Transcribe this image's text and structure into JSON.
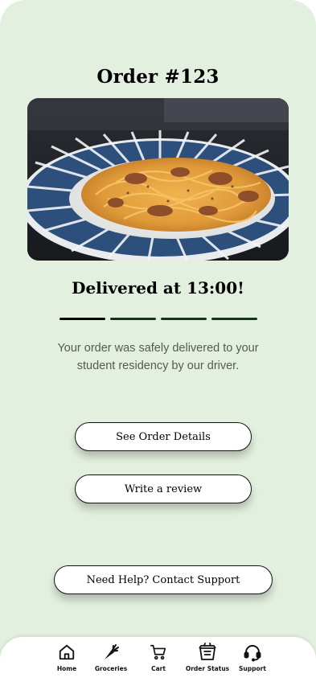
{
  "order": {
    "title": "Order #123"
  },
  "hero": {
    "alt": "spaghetti-carbonara-photo"
  },
  "status": {
    "heading": "Delivered at 13:00!",
    "progress_steps": 4,
    "progress_completed": 4,
    "colors": {
      "step1": "#000000",
      "steps_other": "#0d3a12"
    }
  },
  "description": "Your order was safely delivered to your student residency by our driver.",
  "buttons": {
    "details": "See Order Details",
    "review": "Write a review",
    "support": "Need Help? Contact Support"
  },
  "nav": {
    "items": [
      {
        "label": "Home",
        "icon": "home-icon"
      },
      {
        "label": "Groceries",
        "icon": "carrot-icon"
      },
      {
        "label": "Cart",
        "icon": "cart-icon"
      },
      {
        "label": "Order Status",
        "icon": "takeout-box-icon"
      },
      {
        "label": "Support",
        "icon": "headset-icon"
      }
    ]
  },
  "colors": {
    "background": "#e3f0df",
    "surface": "#ffffff"
  }
}
